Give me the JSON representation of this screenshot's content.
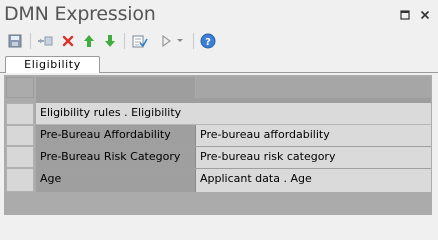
{
  "window": {
    "title": "DMN Expression"
  },
  "icons": {
    "save": "floppy-disk-icon",
    "input": "add-input-icon",
    "delete": "delete-icon",
    "move_up": "arrow-up-icon",
    "move_down": "arrow-down-icon",
    "validate": "validate-icon",
    "run": "play-icon",
    "run_menu": "dropdown-arrow-icon",
    "help": "help-icon",
    "maximize": "maximize-icon",
    "close": "close-icon"
  },
  "tab": {
    "label": "Eligibility"
  },
  "decision": {
    "header": "Eligibility rules . Eligibility"
  },
  "rows": [
    {
      "name": "Pre-Bureau Affordability",
      "value": "Pre-bureau affordability"
    },
    {
      "name": "Pre-Bureau Risk Category",
      "value": "Pre-bureau risk category"
    },
    {
      "name": "Age",
      "value": "Applicant data . Age"
    }
  ]
}
